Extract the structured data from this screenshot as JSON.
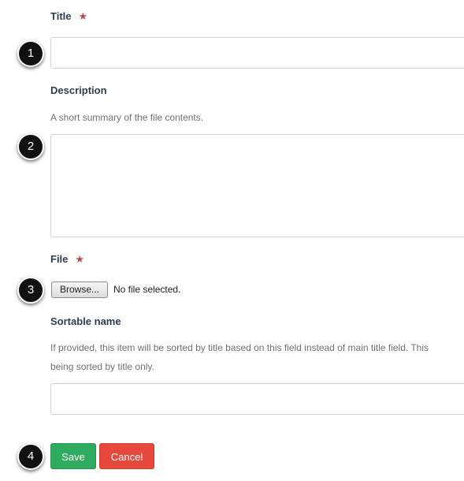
{
  "form": {
    "title": {
      "label": "Title",
      "required_mark": "★",
      "value": "",
      "callout": "1"
    },
    "description": {
      "label": "Description",
      "help": "A short summary of the file contents.",
      "value": "",
      "callout": "2"
    },
    "file": {
      "label": "File",
      "required_mark": "★",
      "browse_label": "Browse...",
      "status": "No file selected.",
      "callout": "3"
    },
    "sortable_name": {
      "label": "Sortable name",
      "help_line1": "If provided, this item will be sorted by title based on this field instead of main title field. This",
      "help_line2": "being sorted by title only.",
      "value": ""
    },
    "actions": {
      "save_label": "Save",
      "cancel_label": "Cancel",
      "callout": "4"
    }
  },
  "colors": {
    "label": "#2d3e50",
    "required_star": "#b94a48",
    "help_text": "#6f6f6f",
    "save_button": "#2eab5e",
    "cancel_button": "#e6493c",
    "callout_badge": "#111111"
  }
}
